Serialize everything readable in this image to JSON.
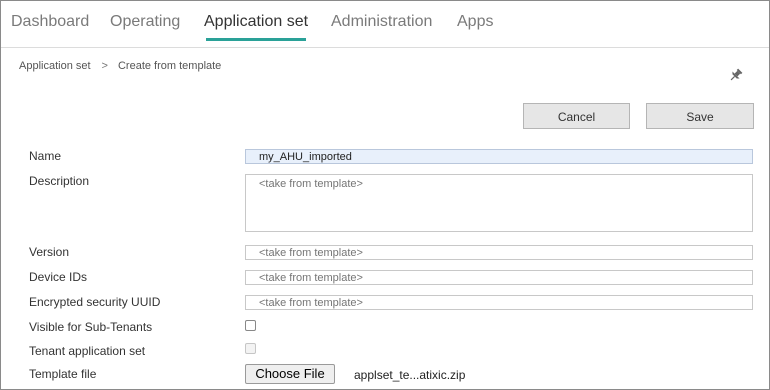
{
  "nav": {
    "tabs": [
      {
        "label": "Dashboard"
      },
      {
        "label": "Operating"
      },
      {
        "label": "Application set"
      },
      {
        "label": "Administration"
      },
      {
        "label": "Apps"
      }
    ],
    "active_tab": "Application set",
    "accent_color": "#2aa198"
  },
  "breadcrumb": {
    "items": [
      "Application set",
      "Create from template"
    ],
    "separator": ">"
  },
  "toolbar": {
    "cancel_label": "Cancel",
    "save_label": "Save",
    "pin_icon": "pin-icon"
  },
  "form": {
    "name": {
      "label": "Name",
      "value": "my_AHU_imported"
    },
    "description": {
      "label": "Description",
      "placeholder": "<take from template>"
    },
    "version": {
      "label": "Version",
      "placeholder": "<take from template>"
    },
    "device_ids": {
      "label": "Device IDs",
      "placeholder": "<take from template>"
    },
    "uuid": {
      "label": "Encrypted security UUID",
      "placeholder": "<take from template>"
    },
    "visible_sub_tenants": {
      "label": "Visible for Sub-Tenants",
      "checked": false
    },
    "tenant_app_set": {
      "label": "Tenant application set",
      "checked": false,
      "disabled": true
    },
    "template_file": {
      "label": "Template file",
      "button_label": "Choose File",
      "file_name": "applset_te...atixic.zip"
    }
  }
}
